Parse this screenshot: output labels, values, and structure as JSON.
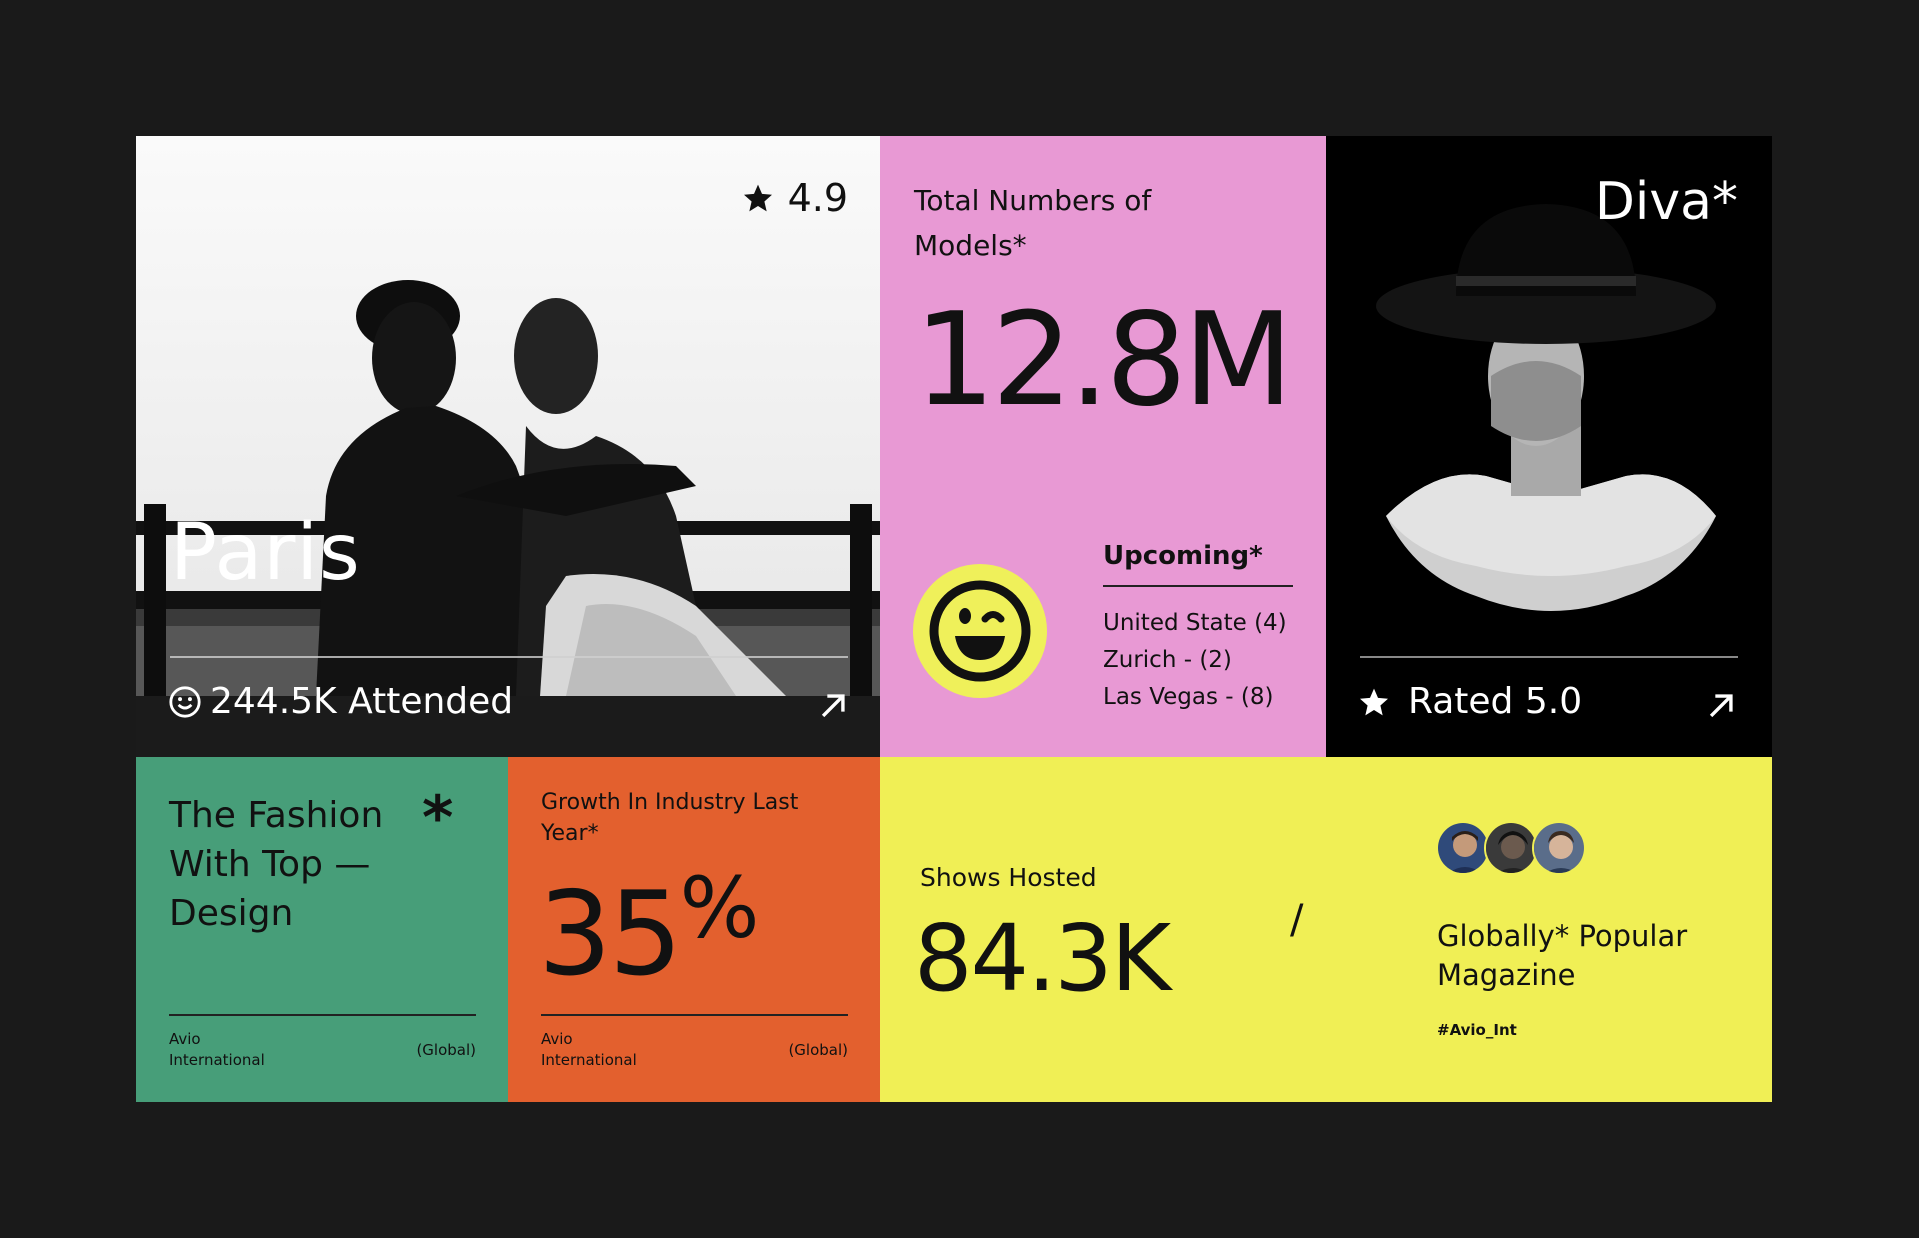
{
  "paris": {
    "rating": "4.9",
    "city": "Paris",
    "attended": "244.5K Attended"
  },
  "models": {
    "label": "Total Numbers of Models*",
    "value": "12.8M",
    "upcoming_title": "Upcoming*",
    "upcoming": [
      "United State (4)",
      "Zurich - (2)",
      "Las Vegas - (8)"
    ]
  },
  "diva": {
    "title": "Diva*",
    "rated": "Rated 5.0"
  },
  "fashion": {
    "title": "The Fashion With Top — Design",
    "asterisk": "*",
    "foot_left": "Avio International",
    "foot_right": "(Global)"
  },
  "growth": {
    "label": "Growth In Industry Last Year*",
    "value": "35",
    "unit": "%",
    "foot_left": "Avio International",
    "foot_right": "(Global)"
  },
  "shows": {
    "label": "Shows Hosted",
    "value": "84.3K",
    "separator": "/",
    "magazine": "Globally* Popular Magazine",
    "hashtag": "#Avio_Int"
  },
  "colors": {
    "background": "#1a1a1a",
    "pink": "#e899d4",
    "green": "#479e79",
    "orange": "#e3602e",
    "yellow": "#f0ef55"
  },
  "icons": [
    "star-icon",
    "smile-icon",
    "arrow-up-right-icon",
    "wink-emoji-icon"
  ]
}
